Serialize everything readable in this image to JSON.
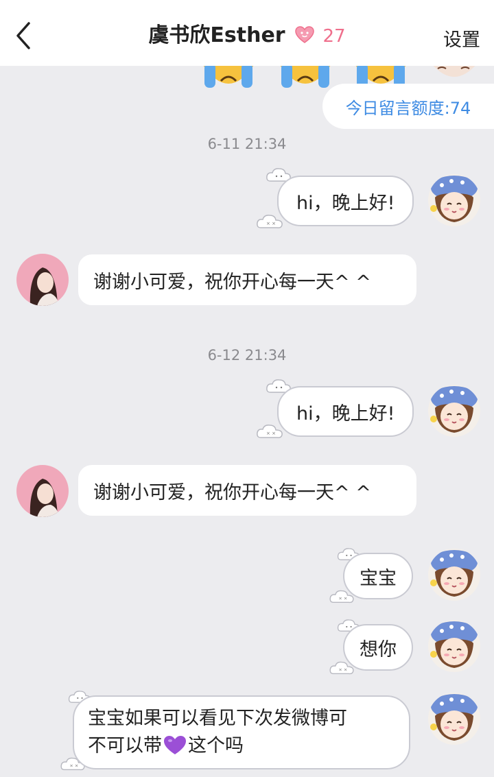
{
  "header": {
    "title": "虞书欣Esther",
    "intimacy_count": "27",
    "settings_label": "设置"
  },
  "quota_label": "今日留言额度:74",
  "messages": [
    {
      "type": "timestamp",
      "text": "6-11 21:34"
    },
    {
      "type": "outgoing",
      "text": "hi，晚上好!"
    },
    {
      "type": "incoming",
      "text": "谢谢小可爱，祝你开心每一天^ ^"
    },
    {
      "type": "timestamp",
      "text": "6-12 21:34"
    },
    {
      "type": "outgoing",
      "text": "hi，晚上好!"
    },
    {
      "type": "incoming",
      "text": "谢谢小可爱，祝你开心每一天^ ^"
    },
    {
      "type": "outgoing",
      "text": "宝宝"
    },
    {
      "type": "outgoing",
      "text": "想你"
    },
    {
      "type": "outgoing",
      "line1": "宝宝如果可以看见下次发微博可",
      "line2_before": "不可以带",
      "line2_after": "这个吗"
    }
  ],
  "colors": {
    "background": "#ececef",
    "quota_text": "#3e8be3",
    "heart": "#ef6f8c",
    "purple_heart": "#9b4fd6"
  },
  "icons": [
    "back-chevron-icon",
    "heart-face-icon",
    "crying-emoji-icon",
    "purple-heart-icon",
    "cloud-bubble-decoration-icon"
  ]
}
